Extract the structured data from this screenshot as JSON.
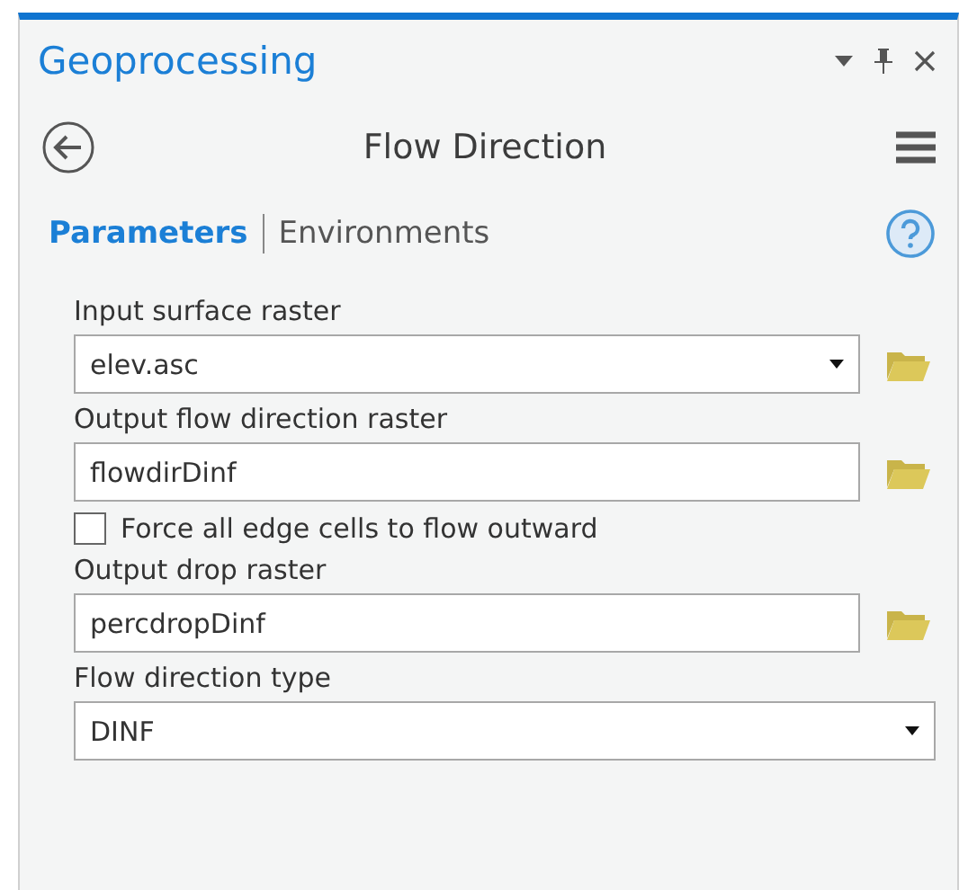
{
  "pane": {
    "title": "Geoprocessing"
  },
  "tool": {
    "title": "Flow Direction"
  },
  "tabs": [
    {
      "label": "Parameters",
      "selected": true
    },
    {
      "label": "Environments",
      "selected": false
    }
  ],
  "parameters": [
    {
      "kind": "dropdown",
      "label": "Input surface raster",
      "value": "elev.asc",
      "browse": true
    },
    {
      "kind": "text",
      "label": "Output flow direction raster",
      "value": "flowdirDinf",
      "browse": true
    },
    {
      "kind": "checkbox",
      "label": "Force all edge cells to flow outward",
      "checked": false
    },
    {
      "kind": "text",
      "label": "Output drop raster",
      "value": "percdropDinf",
      "browse": true
    },
    {
      "kind": "dropdown",
      "label": "Flow direction type",
      "value": "DINF",
      "browse": false
    }
  ]
}
